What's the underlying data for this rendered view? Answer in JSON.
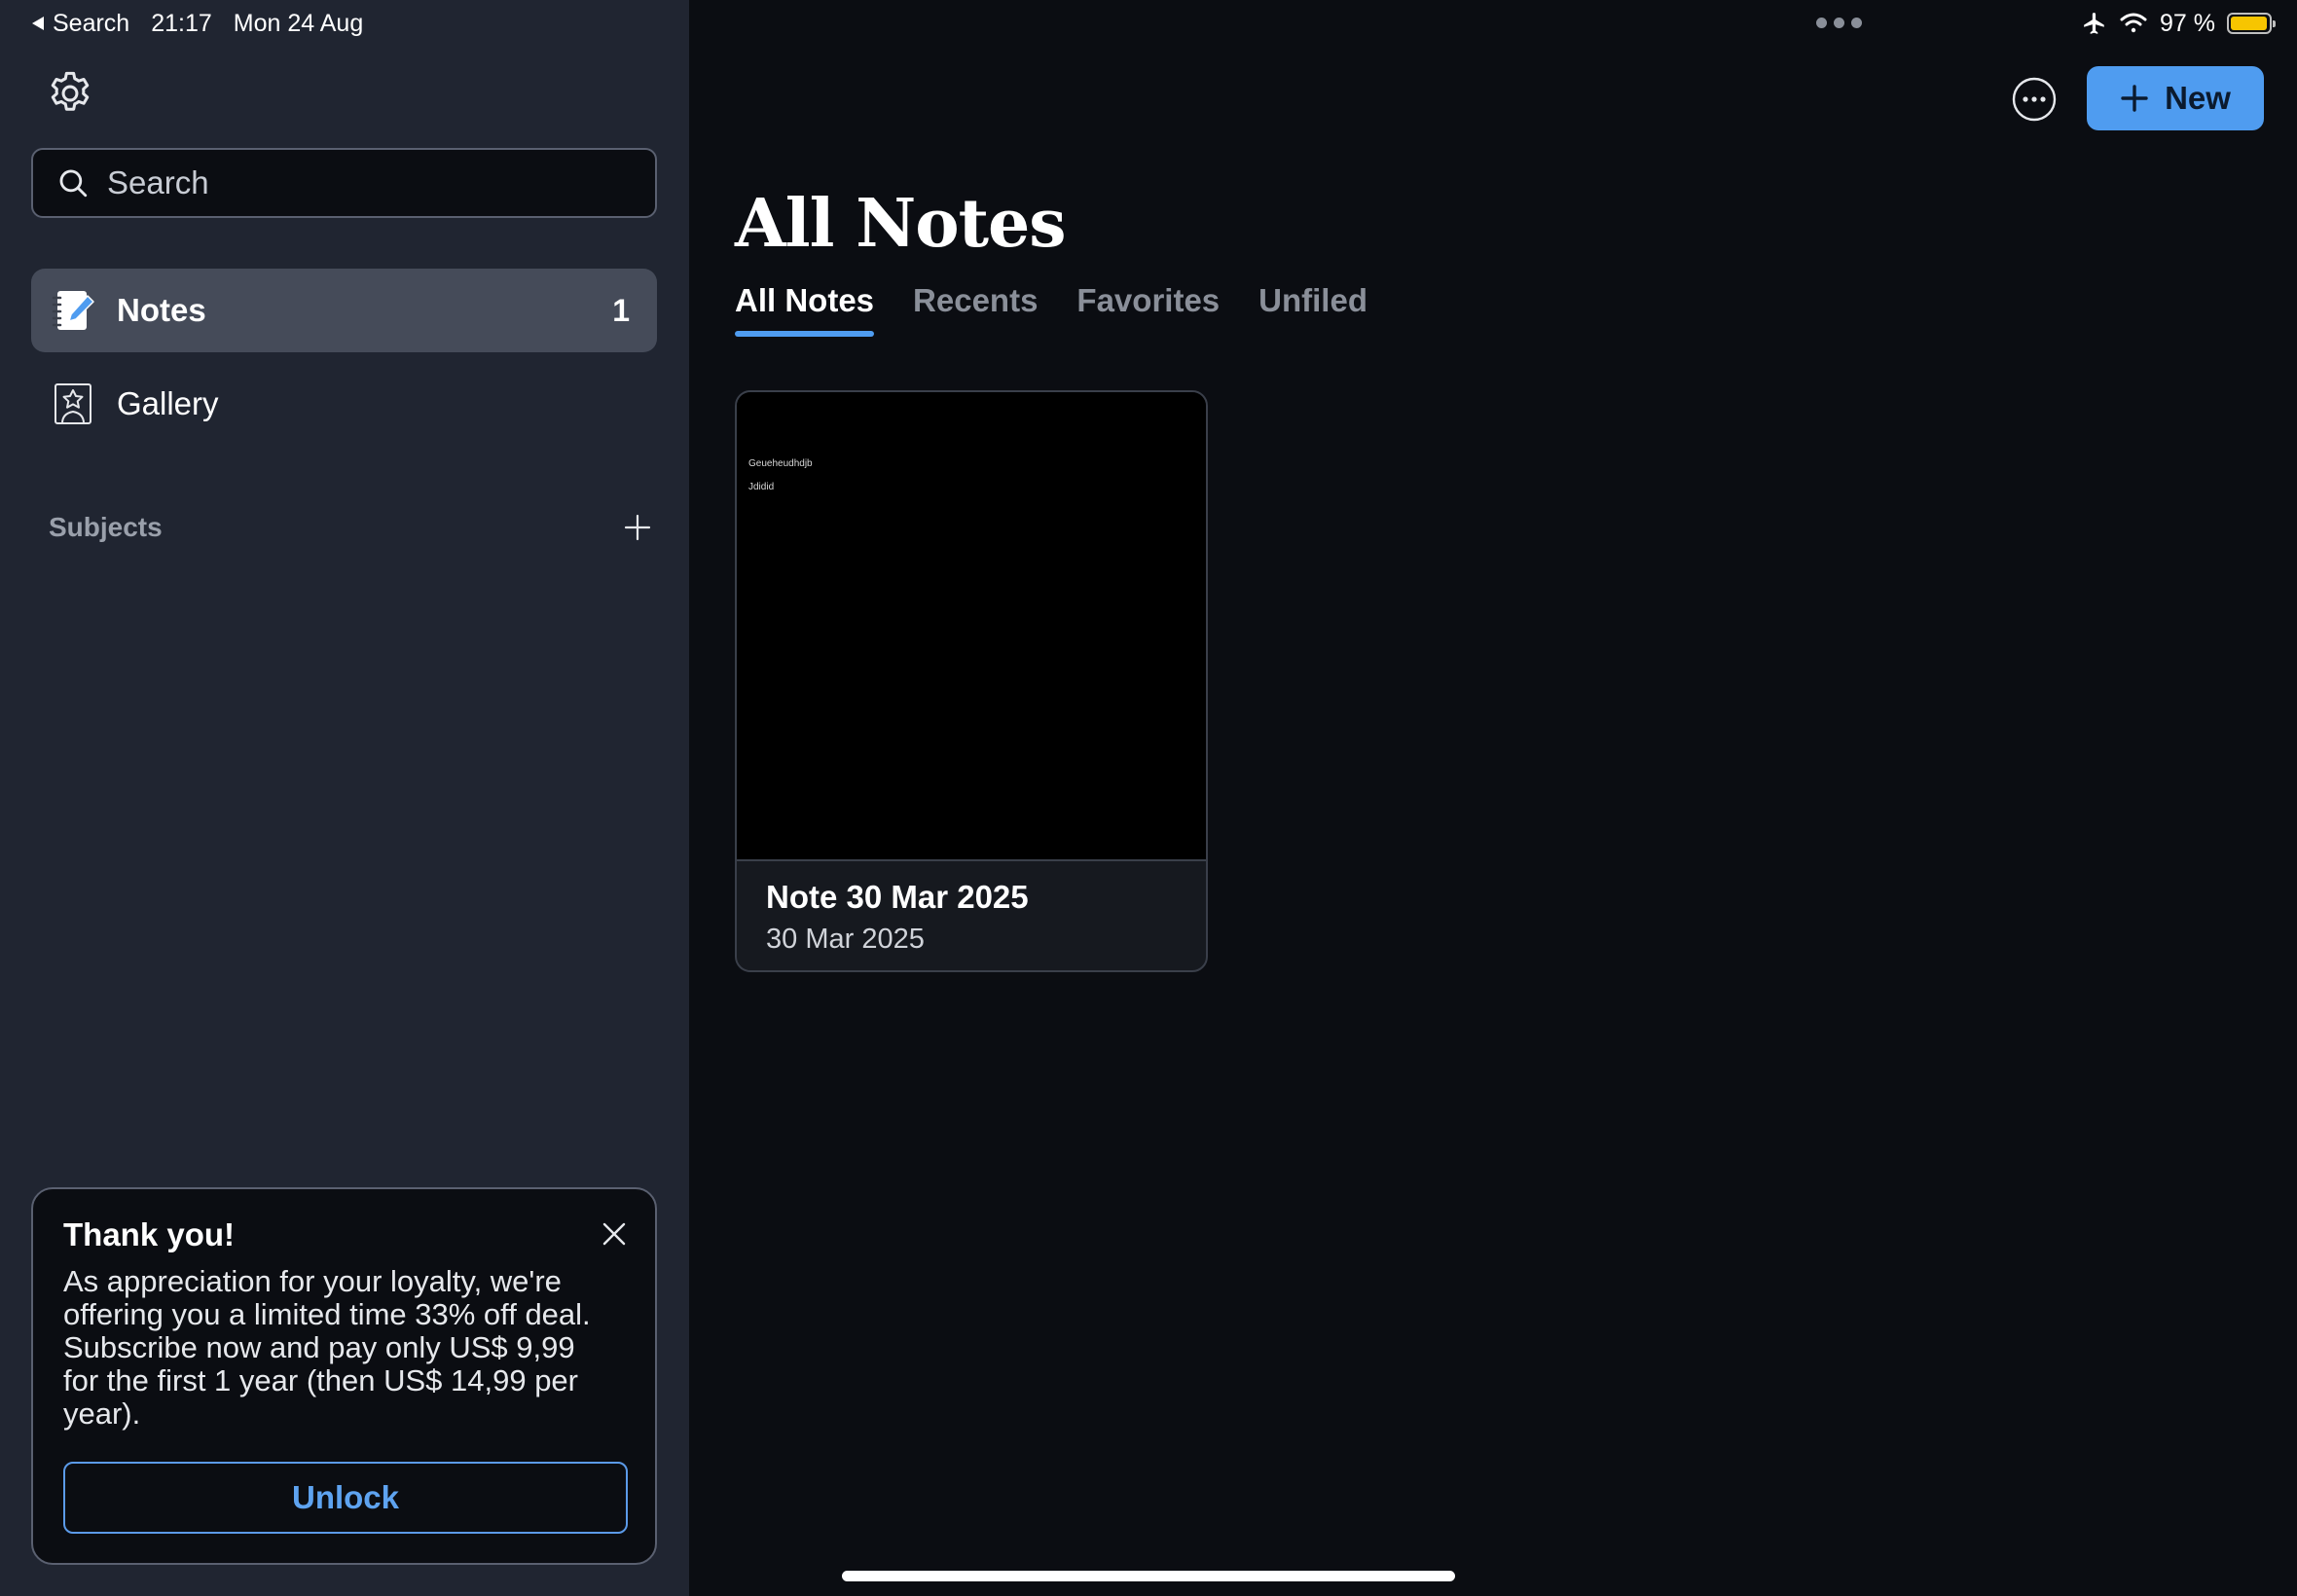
{
  "status_bar": {
    "back_label": "Search",
    "time": "21:17",
    "date": "Mon 24 Aug",
    "battery": "97 %",
    "battery_level": 0.97
  },
  "sidebar": {
    "search_placeholder": "Search",
    "items": [
      {
        "label": "Notes",
        "count": "1",
        "icon": "notebook-pen-icon",
        "active": true
      },
      {
        "label": "Gallery",
        "icon": "gallery-icon",
        "active": false
      }
    ],
    "subjects_label": "Subjects"
  },
  "promo": {
    "title": "Thank you!",
    "body": "As appreciation for your loyalty, we're offering you a limited time 33% off deal. Subscribe now and pay only US$ 9,99 for the first 1 year (then US$ 14,99 per year).",
    "button_label": "Unlock"
  },
  "header": {
    "new_label": "New",
    "title": "All Notes"
  },
  "tabs": [
    {
      "label": "All Notes",
      "active": true
    },
    {
      "label": "Recents",
      "active": false
    },
    {
      "label": "Favorites",
      "active": false
    },
    {
      "label": "Unfiled",
      "active": false
    }
  ],
  "notes": [
    {
      "name": "Note 30 Mar 2025",
      "date": "30 Mar 2025",
      "preview_lines": [
        "Geueheudhdjb",
        "Jdidid"
      ]
    }
  ],
  "colors": {
    "accent": "#4f9cf0",
    "sidebar_bg": "#202531",
    "main_bg": "#0b0d12",
    "battery": "#f7c500"
  }
}
